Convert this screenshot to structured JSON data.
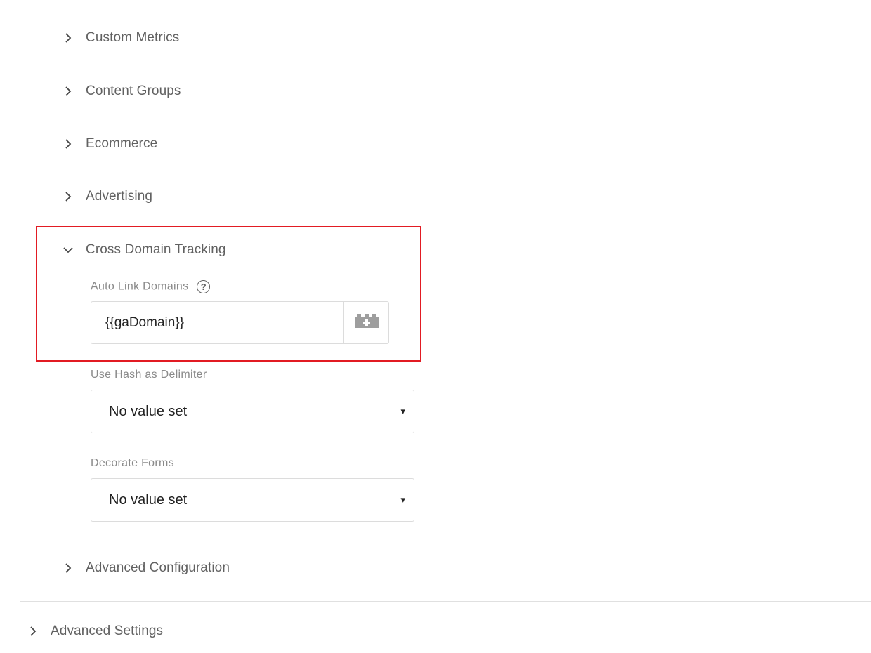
{
  "sections": [
    {
      "label": "Custom Metrics",
      "expanded": false
    },
    {
      "label": "Content Groups",
      "expanded": false
    },
    {
      "label": "Ecommerce",
      "expanded": false
    },
    {
      "label": "Advertising",
      "expanded": false
    },
    {
      "label": "Cross Domain Tracking",
      "expanded": true
    },
    {
      "label": "Advanced Configuration",
      "expanded": false
    }
  ],
  "cross_domain": {
    "auto_link_label": "Auto Link Domains",
    "help_glyph": "?",
    "auto_link_value": "{{gaDomain}}",
    "variable_button_icon": "variable-picker-icon",
    "hash_label": "Use Hash as Delimiter",
    "hash_value": "No value set",
    "forms_label": "Decorate Forms",
    "forms_value": "No value set",
    "caret": "▾"
  },
  "advanced_settings": {
    "label": "Advanced Settings",
    "expanded": false
  },
  "colors": {
    "highlight": "#e21b23",
    "text": "#616161",
    "border": "#dcdcdc"
  }
}
